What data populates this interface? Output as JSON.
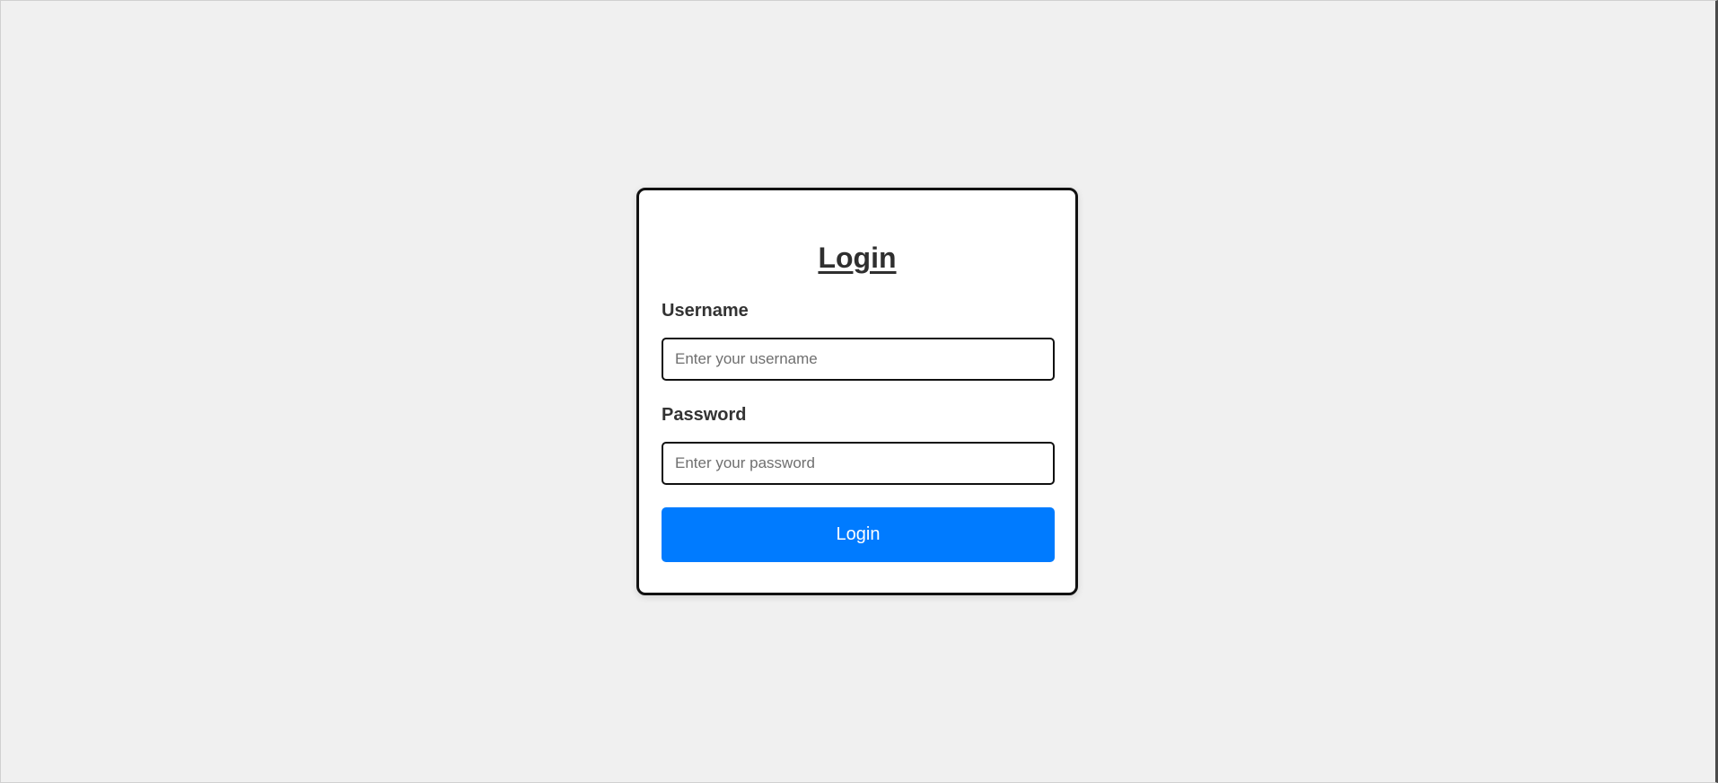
{
  "login_form": {
    "title": "Login",
    "username": {
      "label": "Username",
      "value": "",
      "placeholder": "Enter your username"
    },
    "password": {
      "label": "Password",
      "value": "",
      "placeholder": "Enter your password"
    },
    "submit_label": "Login"
  },
  "colors": {
    "page_background": "#f0f0f0",
    "card_background": "#ffffff",
    "card_border": "#111111",
    "button_primary": "#007bff",
    "button_text": "#ffffff"
  }
}
